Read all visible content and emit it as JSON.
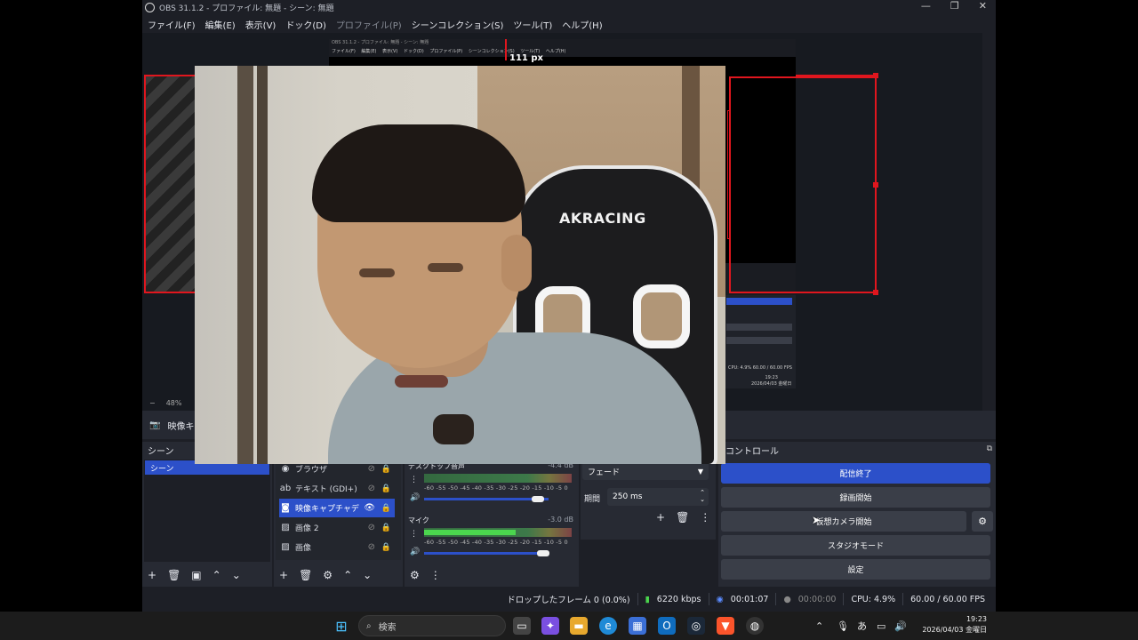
{
  "window": {
    "title": "OBS 31.1.2 - プロファイル: 無題 - シーン: 無題",
    "minimize": "—",
    "maximize": "❐",
    "close": "✕"
  },
  "menu": [
    "ファイル(F)",
    "編集(E)",
    "表示(V)",
    "ドック(D)",
    "プロファイル(P)",
    "シーンコレクション(S)",
    "ツール(T)",
    "ヘルプ(H)"
  ],
  "preview": {
    "distance_label": "111 px",
    "zoom": "48%",
    "zoom_minus": "−"
  },
  "nested": {
    "title": "OBS 31.1.2 - プロファイル: 無題 - シーン: 無題",
    "menu": [
      "ファイル(F)",
      "編集(E)",
      "表示(V)",
      "ドック(D)",
      "プロファイル(P)",
      "シーンコレクション(S)",
      "ツール(T)",
      "ヘルプ(H)"
    ],
    "fps": "CPU: 4.9%    60.00 / 60.00 FPS",
    "clock_time": "19:23",
    "clock_date": "2026/04/03 金曜日"
  },
  "source_bar": {
    "label": "映像キャ"
  },
  "scenes": {
    "title": "シーン",
    "items": [
      "シーン"
    ]
  },
  "sources": {
    "items": [
      {
        "icon": "globe",
        "label": "ブラウザ",
        "selected": false,
        "visible": false
      },
      {
        "icon": "ab",
        "label": "テキスト (GDI+)",
        "selected": false,
        "visible": false
      },
      {
        "icon": "camera",
        "label": "映像キャプチャデ",
        "selected": true,
        "visible": true
      },
      {
        "icon": "image",
        "label": "画像 2",
        "selected": false,
        "visible": false
      },
      {
        "icon": "image",
        "label": "画像",
        "selected": false,
        "visible": false
      }
    ]
  },
  "mixer": {
    "channels": [
      {
        "name": "デスクトップ音声",
        "db": "-4.4 dB",
        "level": 0.0,
        "volume": 0.88
      },
      {
        "name": "マイク",
        "db": "-3.0 dB",
        "level": 0.62,
        "volume": 0.92
      }
    ],
    "scale": "-60 -55 -50 -45 -40 -35 -30 -25 -20 -15 -10  -5  0"
  },
  "transitions": {
    "selected": "フェード",
    "duration_label": "期間",
    "duration_value": "250 ms"
  },
  "controls": {
    "title": "コントロール",
    "stop_stream": "配信終了",
    "start_recording": "録画開始",
    "start_virtual_cam": "仮想カメラ開始",
    "studio_mode": "スタジオモード",
    "settings": "設定"
  },
  "status": {
    "dropped": "ドロップしたフレーム 0 (0.0%)",
    "bitrate": "6220 kbps",
    "stream_time": "00:01:07",
    "rec_time": "00:00:00",
    "cpu": "CPU: 4.9%",
    "fps": "60.00 / 60.00 FPS"
  },
  "webcam": {
    "chair_brand": "AKRACING"
  },
  "taskbar": {
    "search_placeholder": "検索",
    "ime": "あ",
    "time": "19:23",
    "date": "2026/04/03 金曜日"
  },
  "colors": {
    "accent": "#2c50c9",
    "selection_red": "#e0161e",
    "obs_bg": "#1d1f26"
  }
}
